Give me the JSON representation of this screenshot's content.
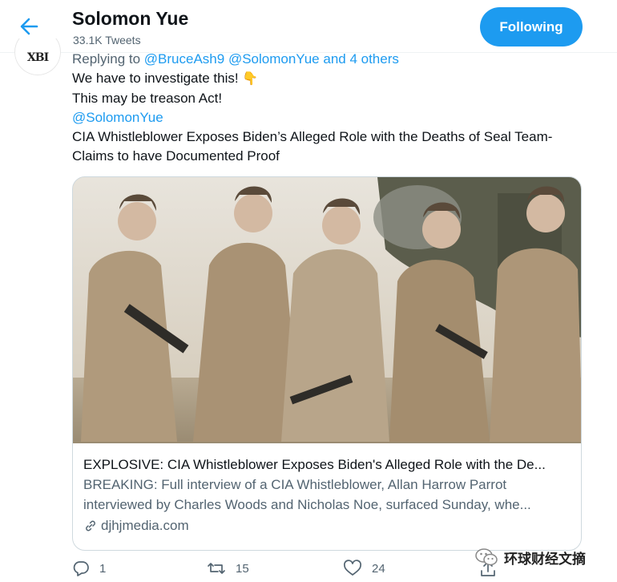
{
  "header": {
    "title": "Solomon Yue",
    "subtitle": "33.1K Tweets",
    "follow_label": "Following"
  },
  "avatar": {
    "text": "XBI"
  },
  "tweet": {
    "replying_to": "Replying to",
    "mentions": [
      "@BruceAsh9",
      "@SolomonYue"
    ],
    "others": "and 4 others",
    "line1": "We have to investigate this!",
    "line1_emoji": "👇",
    "line2": "This may be treason Act!",
    "mention_line": "@SolomonYue",
    "line4": "CIA Whistleblower Exposes Biden’s Alleged Role with the Deaths of Seal Team- Claims to have Documented Proof"
  },
  "card": {
    "title": "EXPLOSIVE: CIA Whistleblower Exposes Biden's Alleged Role with the De...",
    "description": "BREAKING: Full interview of a CIA Whistleblower, Allan Harrow Parrot interviewed by Charles Woods and Nicholas Noe, surfaced Sunday, whe...",
    "domain": "djhjmedia.com"
  },
  "actions": {
    "reply_count": "1",
    "retweet_count": "15",
    "like_count": "24"
  },
  "watermark": {
    "text": "环球财经文摘"
  },
  "colors": {
    "accent": "#1d9bf0",
    "muted": "#536471",
    "text": "#0f1419"
  }
}
